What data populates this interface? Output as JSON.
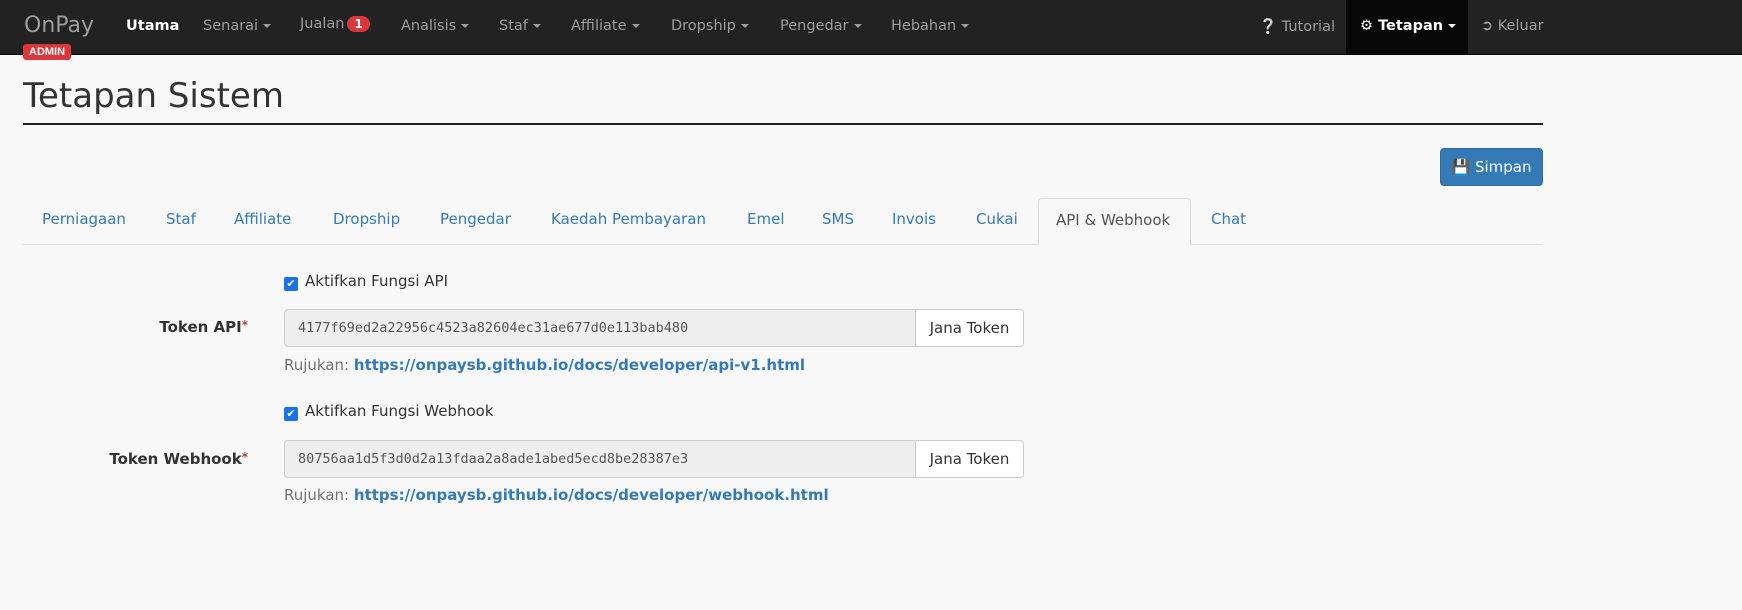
{
  "nav": {
    "brand": "OnPay",
    "admin_badge": "ADMIN",
    "items": [
      {
        "label": "Utama"
      },
      {
        "label": "Senarai"
      },
      {
        "label": "Jualan",
        "badge": "1"
      },
      {
        "label": "Analisis"
      },
      {
        "label": "Staf"
      },
      {
        "label": "Affiliate"
      },
      {
        "label": "Dropship"
      },
      {
        "label": "Pengedar"
      },
      {
        "label": "Hebahan"
      }
    ],
    "tutorial": "Tutorial",
    "settings": "Tetapan",
    "logout": "Keluar"
  },
  "page": {
    "title": "Tetapan Sistem",
    "save": "Simpan"
  },
  "tabs": [
    "Perniagaan",
    "Staf",
    "Affiliate",
    "Dropship",
    "Pengedar",
    "Kaedah Pembayaran",
    "Emel",
    "SMS",
    "Invois",
    "Cukai",
    "API & Webhook",
    "Chat"
  ],
  "form": {
    "api": {
      "checkbox": "Aktifkan Fungsi API",
      "label": "Token API",
      "required": "*",
      "token": "4177f69ed2a22956c4523a82604ec31ae677d0e113bab480",
      "button": "Jana Token",
      "ref_label": "Rujukan:",
      "ref_link": "https://onpaysb.github.io/docs/developer/api-v1.html"
    },
    "webhook": {
      "checkbox": "Aktifkan Fungsi Webhook",
      "label": "Token Webhook",
      "required": "*",
      "token": "80756aa1d5f3d0d2a13fdaa2a8ade1abed5ecd8be28387e3",
      "button": "Jana Token",
      "ref_label": "Rujukan:",
      "ref_link": "https://onpaysb.github.io/docs/developer/webhook.html"
    }
  }
}
